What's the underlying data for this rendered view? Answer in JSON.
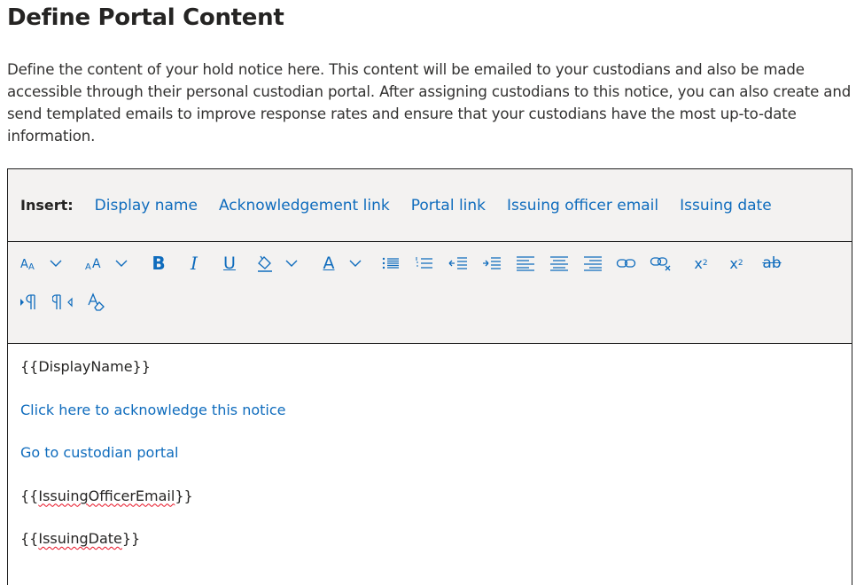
{
  "header": {
    "title": "Define Portal Content",
    "description": "Define the content of your hold notice here. This content will be emailed to your custodians and also be made accessible through their personal custodian portal. After assigning custodians to this notice, you can also create and send templated emails to improve response rates and ensure that your custodians have the most up-to-date information."
  },
  "insert_bar": {
    "label": "Insert:",
    "links": [
      "Display name",
      "Acknowledgement link",
      "Portal link",
      "Issuing officer email",
      "Issuing date"
    ]
  },
  "toolbar": {
    "buttons": [
      "font-size-icon",
      "font-size-dropdown",
      "font-style-icon",
      "font-style-dropdown",
      "bold-icon",
      "italic-icon",
      "underline-icon",
      "highlight-icon",
      "highlight-dropdown",
      "font-color-icon",
      "font-color-dropdown",
      "bullet-list-icon",
      "numbered-list-icon",
      "decrease-indent-icon",
      "increase-indent-icon",
      "align-left-icon",
      "align-center-icon",
      "align-right-icon",
      "insert-link-icon",
      "remove-link-icon",
      "superscript-icon",
      "subscript-icon",
      "strikethrough-icon",
      "ltr-direction-icon",
      "rtl-direction-icon",
      "clear-formatting-icon"
    ],
    "glyphs": {
      "bold": "B",
      "italic": "I",
      "underline": "U",
      "font_color": "A",
      "superscript": "x",
      "subscript": "x",
      "sup_mark": "2",
      "sub_mark": "2",
      "strike": "ab"
    }
  },
  "editor": {
    "display_name": "{{DisplayName}}",
    "ack_link": "Click here to acknowledge this notice",
    "portal_link": "Go to custodian portal",
    "officer_open": "{{",
    "officer_token": "IssuingOfficerEmail",
    "officer_close": "}}",
    "date_open": "{{",
    "date_token": "IssuingDate",
    "date_close": "}}"
  },
  "colors": {
    "accent": "#0f6cbd",
    "toolbar_bg": "#f3f2f1",
    "spellcheck": "#e81123"
  }
}
